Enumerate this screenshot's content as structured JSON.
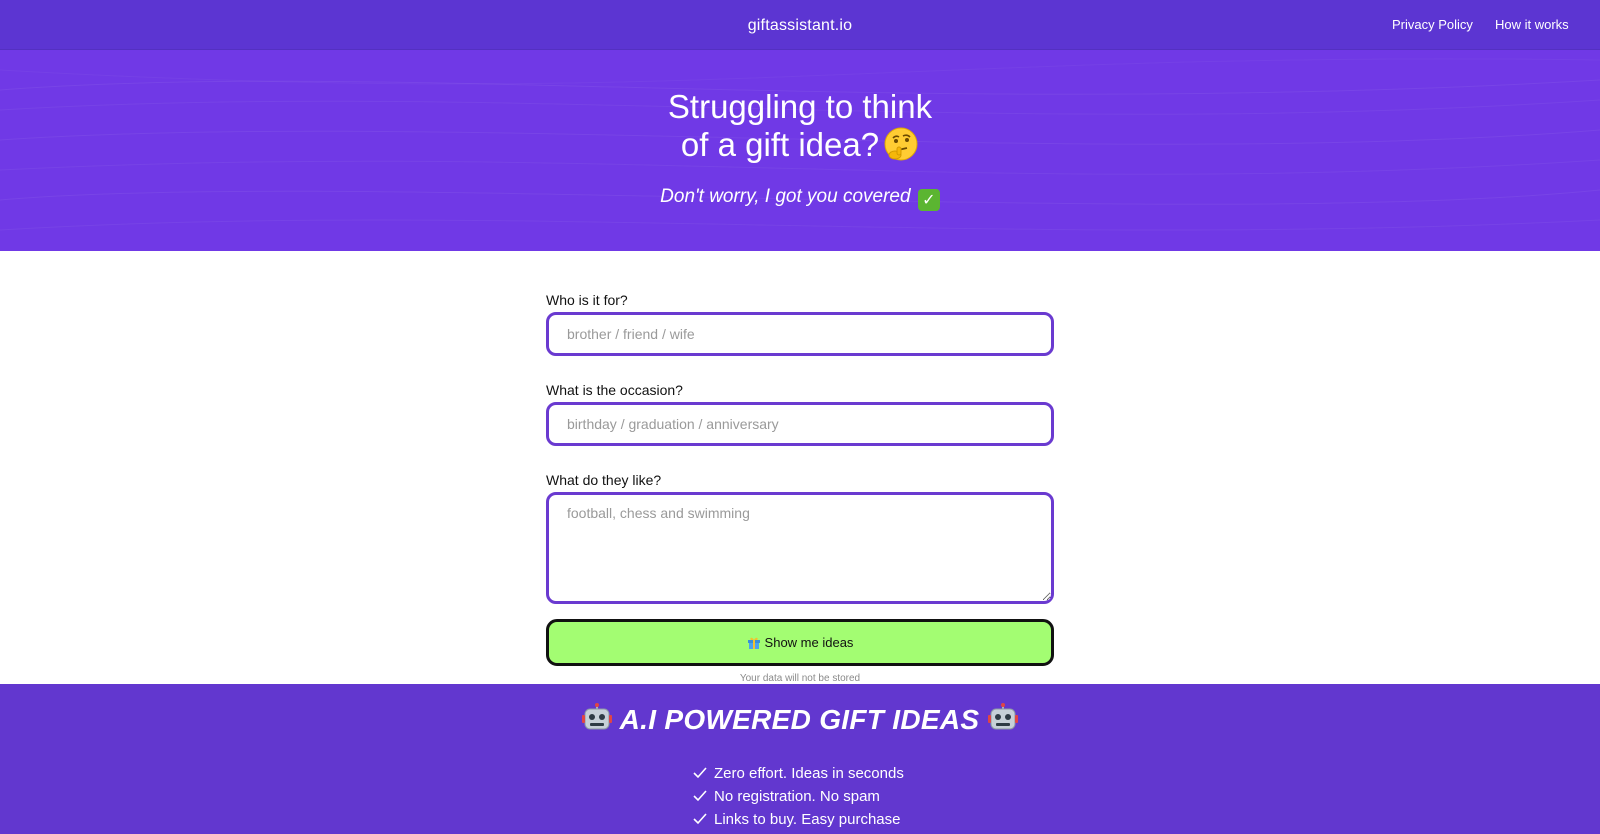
{
  "header": {
    "brand": "giftassistant.io",
    "nav": [
      {
        "label": "Privacy Policy"
      },
      {
        "label": "How it works"
      }
    ]
  },
  "hero": {
    "title_line1": "Struggling to think",
    "title_line2": "of a gift idea?",
    "title_emoji": "thinking-face-icon",
    "subtitle": "Don't worry, I got you covered",
    "subtitle_emoji": "check-mark-button-icon"
  },
  "form": {
    "fields": [
      {
        "label": "Who is it for?",
        "placeholder": "brother / friend / wife",
        "value": ""
      },
      {
        "label": "What is the occasion?",
        "placeholder": "birthday / graduation / anniversary",
        "value": ""
      },
      {
        "label": "What do they like?",
        "placeholder": "football, chess and swimming",
        "value": ""
      }
    ],
    "submit_label": "Show me ideas",
    "submit_icon": "gift-icon",
    "privacy_note": "Your data will not be stored"
  },
  "features": {
    "title": "A.I POWERED GIFT IDEAS",
    "title_icon": "robot-icon",
    "items": [
      {
        "text": "Zero effort. Ideas in seconds"
      },
      {
        "text": "No registration. No spam"
      },
      {
        "text": "Links to buy. Easy purchase"
      }
    ]
  },
  "colors": {
    "nav_bg": "#5c35d2",
    "hero_bg": "#7039e6",
    "input_border": "#6a3ad0",
    "button_bg": "#a3fd72",
    "features_bg": "#6237cf"
  }
}
